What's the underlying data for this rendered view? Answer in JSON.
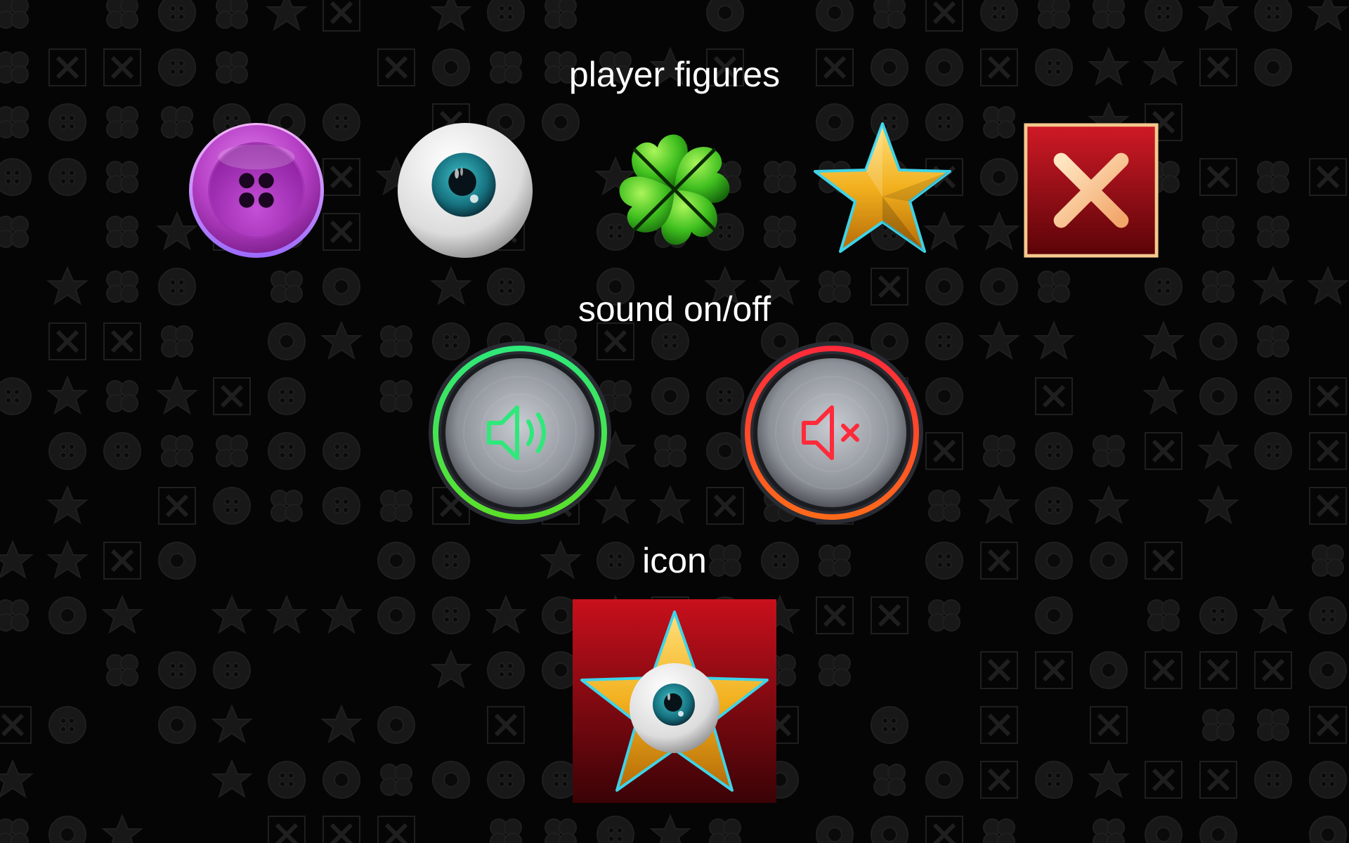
{
  "sections": {
    "player_figures": {
      "title": "player figures",
      "items": [
        {
          "name": "button",
          "icon": "button-icon",
          "color": "#b53fc4"
        },
        {
          "name": "eye",
          "icon": "eyeball-icon",
          "color": "#1e8a9c"
        },
        {
          "name": "clover",
          "icon": "clover-icon",
          "color": "#3fbf1f"
        },
        {
          "name": "star",
          "icon": "star-icon",
          "color": "#f2b01e"
        },
        {
          "name": "cross",
          "icon": "cross-icon",
          "color": "#b5101c"
        }
      ]
    },
    "sound": {
      "title": "sound on/off",
      "on": {
        "icon": "speaker-on-icon",
        "color": "#2ee87a"
      },
      "off": {
        "icon": "speaker-muted-icon",
        "color": "#ff2a3a"
      }
    },
    "app_icon": {
      "title": "icon",
      "icon": "star-eye-app-icon",
      "background": "#b00d18"
    }
  },
  "background_pattern": [
    "button-icon",
    "star-icon",
    "clover-icon",
    "cross-icon",
    "eyeball-icon"
  ]
}
